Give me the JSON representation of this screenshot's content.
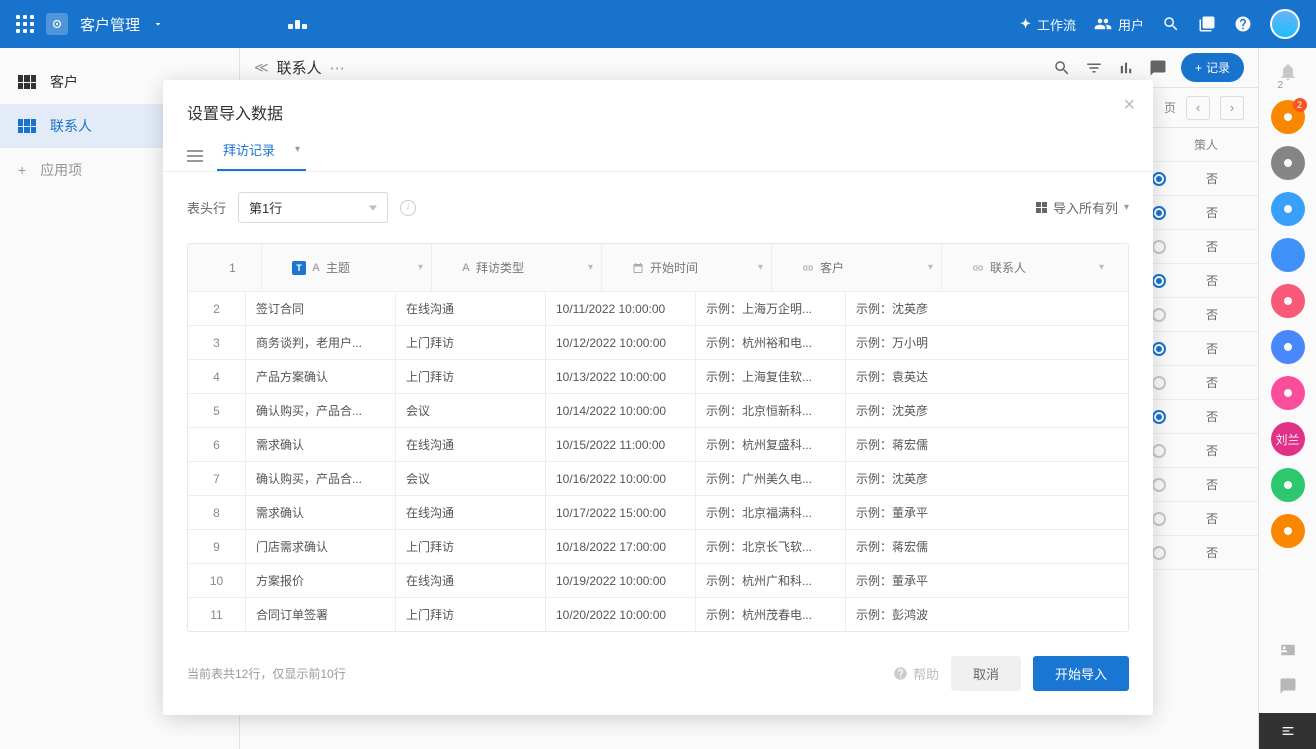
{
  "header": {
    "app_title": "客户管理",
    "workflow": "工作流",
    "users": "用户",
    "notif_count": "2"
  },
  "sidebar": {
    "items": [
      {
        "label": "客户"
      },
      {
        "label": "联系人"
      }
    ],
    "add_label": "应用项"
  },
  "content": {
    "title": "联系人",
    "add_record": "记录",
    "decision_person": "策人",
    "no_label": "否"
  },
  "bg_rows": [
    {
      "on": true
    },
    {
      "on": true
    },
    {
      "on": false
    },
    {
      "on": true
    },
    {
      "on": false
    },
    {
      "on": true
    },
    {
      "on": false
    },
    {
      "on": true
    },
    {
      "on": false
    },
    {
      "on": false
    },
    {
      "on": false
    },
    {
      "on": false
    }
  ],
  "modal": {
    "title": "设置导入数据",
    "tab": "拜访记录",
    "header_row_label": "表头行",
    "header_row_value": "第1行",
    "import_all_cols": "导入所有列",
    "columns": [
      {
        "name": "主题",
        "type": "T"
      },
      {
        "name": "拜访类型",
        "type": "A"
      },
      {
        "name": "开始时间",
        "type": "date"
      },
      {
        "name": "客户",
        "type": "link"
      },
      {
        "name": "联系人",
        "type": "link"
      }
    ],
    "rows": [
      {
        "n": "2",
        "c": [
          "签订合同",
          "在线沟通",
          "10/11/2022 10:00:00",
          "示例：上海万企明...",
          "示例：沈英彦"
        ]
      },
      {
        "n": "3",
        "c": [
          "商务谈判，老用户...",
          "上门拜访",
          "10/12/2022 10:00:00",
          "示例：杭州裕和电...",
          "示例：万小明"
        ]
      },
      {
        "n": "4",
        "c": [
          "产品方案确认",
          "上门拜访",
          "10/13/2022 10:00:00",
          "示例：上海复佳软...",
          "示例：袁英达"
        ]
      },
      {
        "n": "5",
        "c": [
          "确认购买，产品合...",
          "会议",
          "10/14/2022 10:00:00",
          "示例：北京恒新科...",
          "示例：沈英彦"
        ]
      },
      {
        "n": "6",
        "c": [
          "需求确认",
          "在线沟通",
          "10/15/2022 11:00:00",
          "示例：杭州复盛科...",
          "示例：蒋宏儒"
        ]
      },
      {
        "n": "7",
        "c": [
          "确认购买，产品合...",
          "会议",
          "10/16/2022 10:00:00",
          "示例：广州美久电...",
          "示例：沈英彦"
        ]
      },
      {
        "n": "8",
        "c": [
          "需求确认",
          "在线沟通",
          "10/17/2022 15:00:00",
          "示例：北京福满科...",
          "示例：董承平"
        ]
      },
      {
        "n": "9",
        "c": [
          "门店需求确认",
          "上门拜访",
          "10/18/2022 17:00:00",
          "示例：北京长飞软...",
          "示例：蒋宏儒"
        ]
      },
      {
        "n": "10",
        "c": [
          "方案报价",
          "在线沟通",
          "10/19/2022 10:00:00",
          "示例：杭州广和科...",
          "示例：董承平"
        ]
      },
      {
        "n": "11",
        "c": [
          "合同订单签署",
          "上门拜访",
          "10/20/2022 10:00:00",
          "示例：杭州茂春电...",
          "示例：彭鸿波"
        ]
      }
    ],
    "foot_note": "当前表共12行，仅显示前10行",
    "help": "帮助",
    "cancel": "取消",
    "start": "开始导入"
  },
  "rightrail": {
    "notif_n": "2",
    "dots": [
      {
        "color": "#ff8a00",
        "badge": "2"
      },
      {
        "color": "#888"
      },
      {
        "color": "#3aa3ff"
      },
      {
        "color": "#4394ff",
        "img": true
      },
      {
        "color": "#ff5b7d"
      },
      {
        "color": "#4b8bff"
      },
      {
        "color": "#ff4fa0"
      },
      {
        "color": "#e6338c",
        "label": "刘兰"
      },
      {
        "color": "#2ecc71"
      },
      {
        "color": "#ff8a00"
      }
    ]
  }
}
